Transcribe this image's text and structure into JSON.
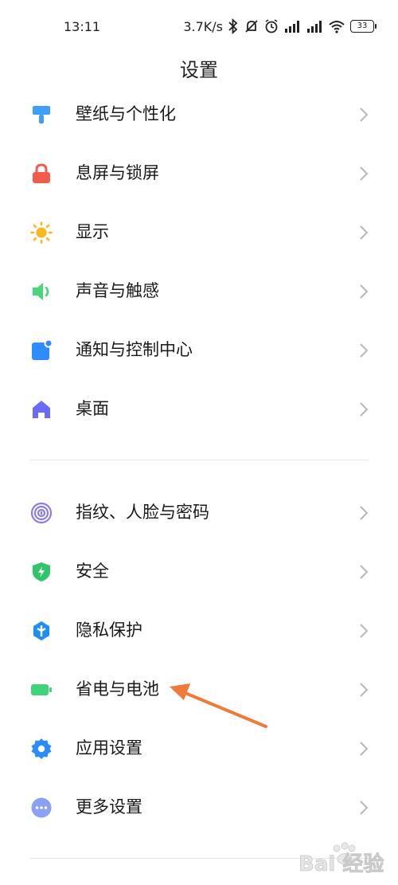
{
  "status_bar": {
    "time": "13:11",
    "network_speed": "3.7K/s",
    "battery": "33"
  },
  "page": {
    "title": "设置"
  },
  "group1": [
    {
      "label": "壁纸与个性化",
      "icon": "paint-roller-icon",
      "color": "#3d9eff"
    },
    {
      "label": "息屏与锁屏",
      "icon": "lock-icon",
      "color": "#f25d4b"
    },
    {
      "label": "显示",
      "icon": "sun-icon",
      "color": "#f9b81e"
    },
    {
      "label": "声音与触感",
      "icon": "speaker-icon",
      "color": "#4cd47b"
    },
    {
      "label": "通知与控制中心",
      "icon": "notification-icon",
      "color": "#2f8cff"
    },
    {
      "label": "桌面",
      "icon": "home-icon",
      "color": "#6a6cf5"
    }
  ],
  "group2": [
    {
      "label": "指纹、人脸与密码",
      "icon": "fingerprint-icon",
      "color": "#8a7cf0"
    },
    {
      "label": "安全",
      "icon": "shield-icon",
      "color": "#2fc56a"
    },
    {
      "label": "隐私保护",
      "icon": "privacy-icon",
      "color": "#1f8ff5"
    },
    {
      "label": "省电与电池",
      "icon": "battery-icon",
      "color": "#3fd37a"
    },
    {
      "label": "应用设置",
      "icon": "gear-icon",
      "color": "#2a8dff"
    },
    {
      "label": "更多设置",
      "icon": "more-icon",
      "color": "#8aa1f5"
    }
  ],
  "annotation": {
    "arrow_color": "#f07a3a"
  },
  "watermark": {
    "text": "Bai 经验"
  }
}
